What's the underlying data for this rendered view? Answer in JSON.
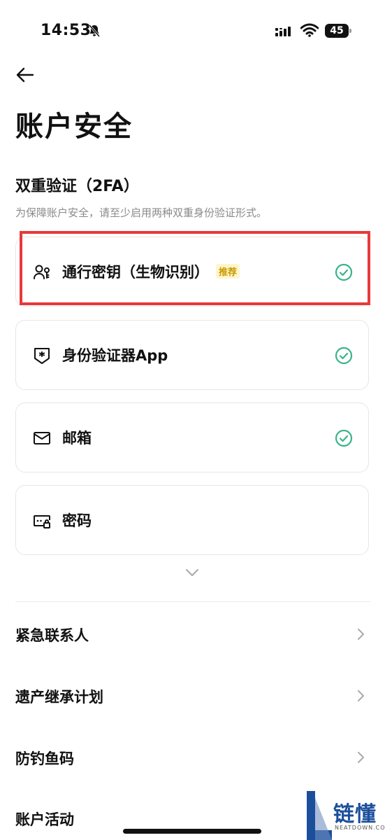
{
  "status_bar": {
    "time": "14:53",
    "battery": "45"
  },
  "header": {
    "title": "账户安全"
  },
  "two_factor": {
    "title": "双重验证（2FA）",
    "description": "为保障账户安全，请至少启用两种双重身份验证形式。",
    "methods": [
      {
        "label": "通行密钥（生物识别）",
        "badge": "推荐",
        "icon": "passkey-icon",
        "enabled": true
      },
      {
        "label": "身份验证器App",
        "icon": "authenticator-icon",
        "enabled": true
      },
      {
        "label": "邮箱",
        "icon": "mail-icon",
        "enabled": true
      },
      {
        "label": "密码",
        "icon": "password-icon",
        "enabled": false
      }
    ]
  },
  "menu": [
    {
      "label": "紧急联系人"
    },
    {
      "label": "遗产继承计划"
    },
    {
      "label": "防钓鱼码"
    },
    {
      "label": "账户活动"
    }
  ],
  "watermark": {
    "text": "链懂",
    "sub": "NEATDOWN.COM"
  },
  "colors": {
    "check": "#3bb38a",
    "highlight": "#e8393a",
    "badge_text": "#c79a00",
    "badge_bg": "#fff5cc"
  }
}
